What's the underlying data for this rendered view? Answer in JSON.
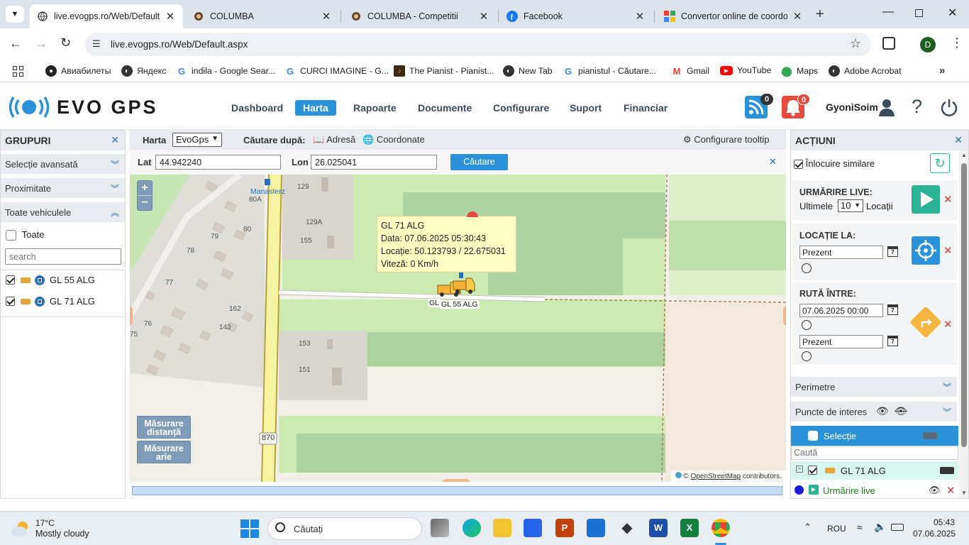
{
  "browser": {
    "tabs": [
      {
        "title": "live.evogps.ro/Web/Default.a",
        "active": true
      },
      {
        "title": "COLUMBA",
        "active": false
      },
      {
        "title": "COLUMBA - Competitii",
        "active": false
      },
      {
        "title": "Facebook",
        "active": false
      },
      {
        "title": "Convertor online de coordon",
        "active": false
      }
    ],
    "url": "live.evogps.ro/Web/Default.aspx",
    "profile_initial": "D",
    "bookmarks": [
      {
        "label": "Авиабилеты",
        "icon": "github-icon"
      },
      {
        "label": "Яндекс",
        "icon": "globe-icon"
      },
      {
        "label": "indila - Google Sear...",
        "icon": "google-icon"
      },
      {
        "label": "CURCI IMAGINE - G...",
        "icon": "google-icon"
      },
      {
        "label": "The Pianist - Pianist...",
        "icon": "pianist-icon"
      },
      {
        "label": "New Tab",
        "icon": "globe-icon"
      },
      {
        "label": "pianistul - Căutare...",
        "icon": "google-icon"
      },
      {
        "label": "Gmail",
        "icon": "gmail-icon"
      },
      {
        "label": "YouTube",
        "icon": "youtube-icon"
      },
      {
        "label": "Maps",
        "icon": "maps-icon"
      },
      {
        "label": "Adobe Acrobat",
        "icon": "globe-icon"
      }
    ]
  },
  "app": {
    "logo": "EVO GPS",
    "nav": [
      {
        "label": "Dashboard",
        "active": false
      },
      {
        "label": "Harta",
        "active": true
      },
      {
        "label": "Rapoarte",
        "active": false
      },
      {
        "label": "Documente",
        "active": false
      },
      {
        "label": "Configurare",
        "active": false
      },
      {
        "label": "Suport",
        "active": false
      },
      {
        "label": "Financiar",
        "active": false
      }
    ],
    "rss_badge": "0",
    "bell_badge": "0",
    "username": "GyoniSoim"
  },
  "left": {
    "title": "GRUPURI",
    "sections": [
      "Selecție avansată",
      "Proximitate",
      "Toate vehiculele"
    ],
    "all_label": "Toate",
    "search_placeholder": "search",
    "vehicles": [
      {
        "name": "GL 55 ALG",
        "checked": true
      },
      {
        "name": "GL 71 ALG",
        "checked": true
      }
    ]
  },
  "map": {
    "harta_label": "Harta",
    "layer_select": "EvoGps",
    "search_by_label": "Căutare după:",
    "address_label": "Adresă",
    "coords_label": "Coordonate",
    "tooltip_config": "Configurare tooltip",
    "lat_label": "Lat",
    "lat_value": "44.942240",
    "lon_label": "Lon",
    "lon_value": "26.025041",
    "search_button": "Căutare",
    "zoom_in": "+",
    "zoom_out": "−",
    "measure_distance": "Măsurare distanță",
    "measure_area": "Măsurare arie",
    "attribution_prefix": "©",
    "attribution_link": "OpenStreetMap",
    "attribution_suffix": "contributors.",
    "place_label": "Manasterz",
    "road_label": "870",
    "house_numbers": [
      "129",
      "80A",
      "129A",
      "80",
      "79",
      "155",
      "78",
      "77",
      "162",
      "76",
      "143",
      "75",
      "153",
      "151"
    ],
    "popup": {
      "line1": "GL 71 ALG",
      "line2": "Data: 07.06.2025 05:30:43",
      "line3": "Locație: 50.123793 / 22.675031",
      "line4": "Viteză: 0 Km/h"
    },
    "marker_labels": [
      "GL",
      "GL 55 ALG"
    ]
  },
  "right": {
    "title": "ACȚIUNI",
    "replace_similar": "Înlocuire similare",
    "live_title": "URMĂRIRE LIVE:",
    "live_last": "Ultimele",
    "live_count": "10",
    "live_locations": "Locații",
    "location_title": "LOCAȚIE LA:",
    "location_value": "Prezent",
    "route_title": "RUTĂ ÎNTRE:",
    "route_from": "07.06.2025 00:00",
    "route_to": "Prezent",
    "perimeters": "Perimetre",
    "poi": "Puncte de interes",
    "selection": "Selecție",
    "search_placeholder": "Caută",
    "tree_vehicle": "GL 71 ALG",
    "tree_live": "Urmărire live"
  },
  "taskbar": {
    "weather_temp": "17°C",
    "weather_desc": "Mostly cloudy",
    "search_placeholder": "Căutați",
    "lang": "ROU",
    "time": "05:43",
    "date": "07.06.2025"
  },
  "colors": {
    "accent": "#2a92d9",
    "map_green": "#c8e6b4",
    "map_field": "#f2e9dc",
    "popup_bg": "#ffffc4",
    "tree_highlight": "#d8f6ef"
  }
}
